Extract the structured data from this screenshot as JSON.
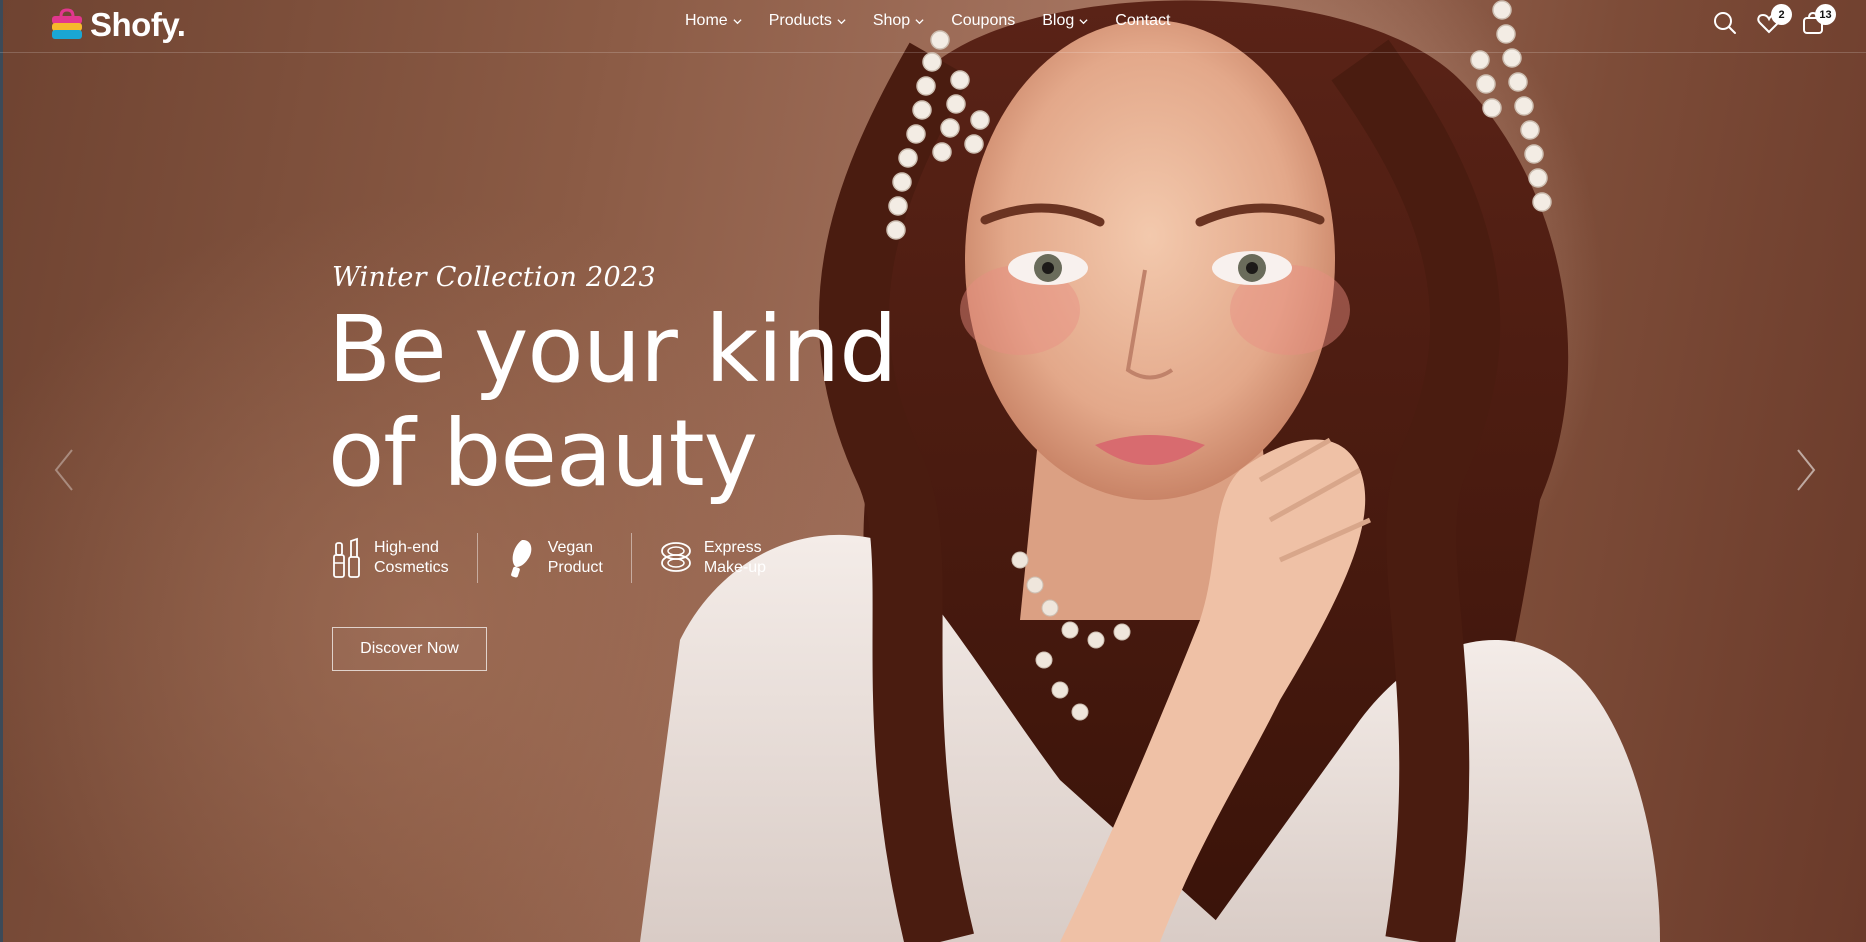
{
  "brand": {
    "name": "Shofy."
  },
  "nav": {
    "items": [
      {
        "label": "Home",
        "has_dropdown": true
      },
      {
        "label": "Products",
        "has_dropdown": true
      },
      {
        "label": "Shop",
        "has_dropdown": true
      },
      {
        "label": "Coupons",
        "has_dropdown": false
      },
      {
        "label": "Blog",
        "has_dropdown": true
      },
      {
        "label": "Contact",
        "has_dropdown": false
      }
    ]
  },
  "header_icons": {
    "search": "search-icon",
    "wishlist": {
      "icon": "heart-icon",
      "count": "2"
    },
    "cart": {
      "icon": "shopping-bag-icon",
      "count": "13"
    }
  },
  "hero": {
    "subtitle": "Winter Collection 2023",
    "title_line1": "Be your kind",
    "title_line2": "of beauty",
    "features": [
      {
        "icon": "lipstick-icon",
        "line1": "High-end",
        "line2": "Cosmetics"
      },
      {
        "icon": "brush-icon",
        "line1": "Vegan",
        "line2": "Product"
      },
      {
        "icon": "compact-powder-icon",
        "line1": "Express",
        "line2": "Make-up"
      }
    ],
    "cta_label": "Discover Now"
  },
  "colors": {
    "accent_text": "#ffffff",
    "background": "#8a5a44"
  }
}
